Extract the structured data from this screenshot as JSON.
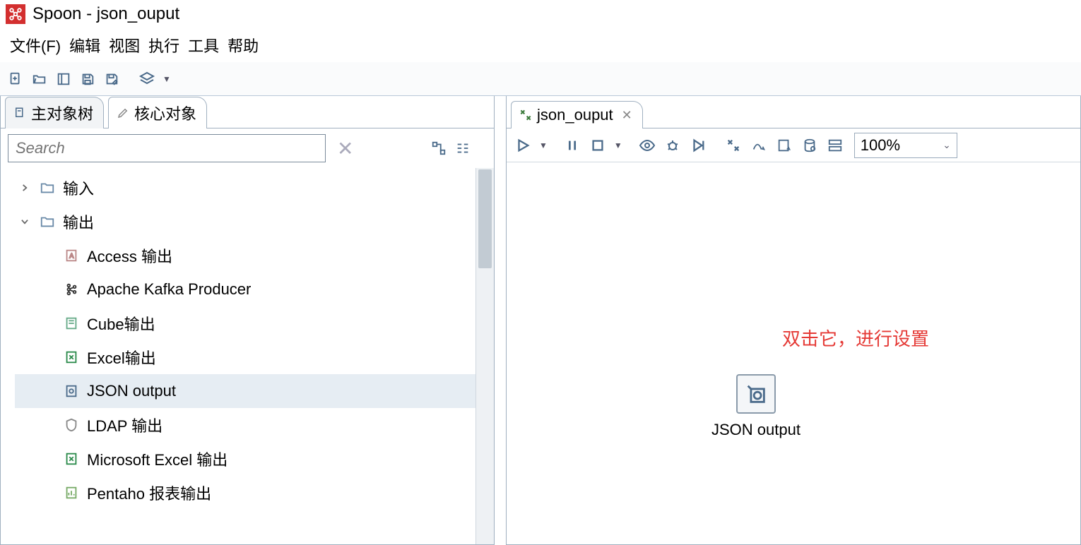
{
  "window": {
    "title": "Spoon - json_ouput"
  },
  "menu": {
    "file": "文件(F)",
    "edit": "编辑",
    "view": "视图",
    "run": "执行",
    "tools": "工具",
    "help": "帮助"
  },
  "leftTabs": {
    "main": "主对象树",
    "core": "核心对象"
  },
  "search": {
    "placeholder": "Search"
  },
  "tree": {
    "input": "输入",
    "output": "输出",
    "children": {
      "access": "Access 输出",
      "kafka": "Apache Kafka Producer",
      "cube": "Cube输出",
      "excel": "Excel输出",
      "json": "JSON output",
      "ldap": "LDAP 输出",
      "msexcel": "Microsoft Excel 输出",
      "pentaho": "Pentaho 报表输出"
    }
  },
  "rightTab": {
    "label": "json_ouput"
  },
  "zoom": {
    "value": "100%"
  },
  "canvas": {
    "nodeLabel": "JSON output",
    "annotation": "双击它，进行设置"
  }
}
